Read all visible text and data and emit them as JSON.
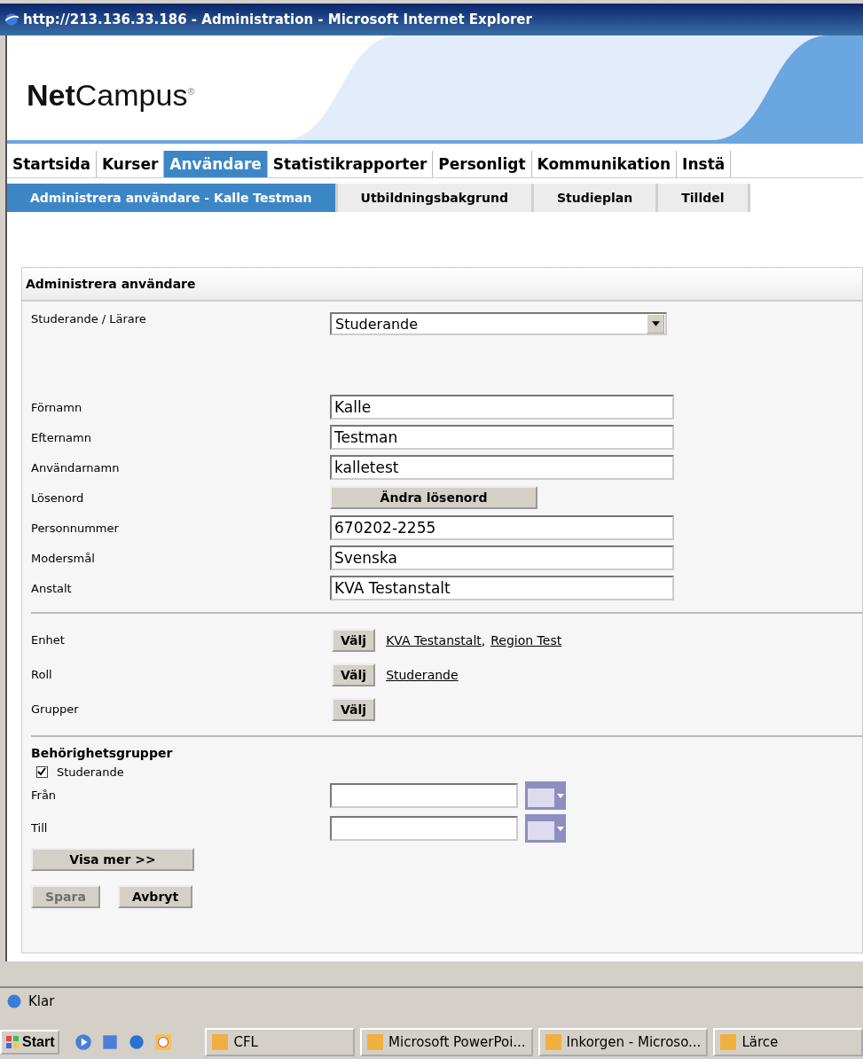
{
  "window": {
    "title": "http://213.136.33.186 - Administration - Microsoft Internet Explorer"
  },
  "logo": {
    "bold": "Net",
    "rest": "Campus",
    "mark": "®"
  },
  "tabs": [
    {
      "label": "Startsida",
      "selected": false
    },
    {
      "label": "Kurser",
      "selected": false
    },
    {
      "label": "Användare",
      "selected": true
    },
    {
      "label": "Statistikrapporter",
      "selected": false
    },
    {
      "label": "Personligt",
      "selected": false
    },
    {
      "label": "Kommunikation",
      "selected": false
    },
    {
      "label": "Instä",
      "selected": false
    }
  ],
  "subtabs": [
    {
      "label": "Administrera användare - Kalle Testman",
      "selected": true
    },
    {
      "label": "Utbildningsbakgrund",
      "selected": false
    },
    {
      "label": "Studieplan",
      "selected": false
    },
    {
      "label": "Tilldel",
      "selected": false
    }
  ],
  "panel": {
    "title": "Administrera användare",
    "fields": [
      {
        "kind": "select",
        "label": "Studerande / Lärare",
        "value": "Studerande"
      },
      {
        "kind": "text",
        "label": "Förnamn",
        "value": "Kalle"
      },
      {
        "kind": "text",
        "label": "Efternamn",
        "value": "Testman"
      },
      {
        "kind": "text",
        "label": "Användarnamn",
        "value": "kalletest"
      },
      {
        "kind": "button",
        "label": "Lösenord",
        "value": "Ändra lösenord"
      },
      {
        "kind": "text",
        "label": "Personnummer",
        "value": "670202-2255"
      },
      {
        "kind": "text",
        "label": "Modersmål",
        "value": "Svenska"
      },
      {
        "kind": "text",
        "label": "Anstalt",
        "value": "KVA Testanstalt"
      }
    ],
    "pickers": [
      {
        "label": "Enhet",
        "button": "Välj",
        "links": [
          {
            "text": "KVA Testanstalt",
            "separator": ","
          },
          {
            "text": "Region Test"
          }
        ]
      },
      {
        "label": "Roll",
        "button": "Välj",
        "links": [
          {
            "text": "Studerande"
          }
        ]
      },
      {
        "label": "Grupper",
        "button": "Välj"
      }
    ],
    "permissions": {
      "title": "Behörighetsgrupper",
      "checkbox": {
        "label": "Studerande",
        "checked": true
      },
      "dates": [
        {
          "label": "Från"
        },
        {
          "label": "Till"
        }
      ],
      "more_button": "Visa mer >>"
    },
    "actions": [
      {
        "label": "Spara",
        "disabled": true
      },
      {
        "label": "Avbryt",
        "disabled": false
      }
    ]
  },
  "status_bar": {
    "text": "Klar"
  },
  "taskbar": {
    "start": "Start",
    "tasks": [
      {
        "label": "CFL"
      },
      {
        "label": "Microsoft PowerPoi..."
      },
      {
        "label": "Inkorgen - Microso..."
      },
      {
        "label": "Lärce"
      }
    ]
  }
}
